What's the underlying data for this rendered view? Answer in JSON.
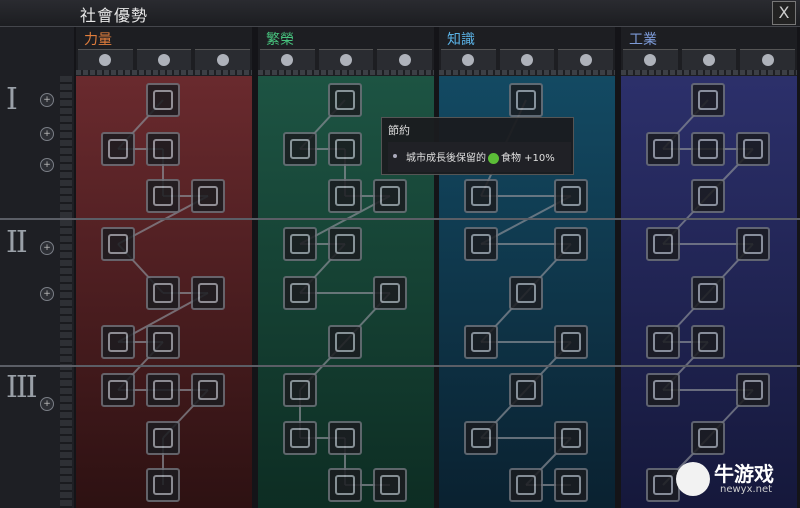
{
  "window": {
    "title": "社會優勢",
    "close_label": "X"
  },
  "tiers": [
    {
      "label": "I"
    },
    {
      "label": "II"
    },
    {
      "label": "III"
    }
  ],
  "columns": [
    {
      "name": "力量",
      "color": "#e07d3c",
      "bg_top": "#6a2a2e",
      "bg_bot": "#2d1112",
      "header_icons": [
        "fist-icon",
        "arm-icon",
        "arm-icon"
      ],
      "nodes_icons": [
        "chevrons-icon",
        "sword-icon",
        "person-icon",
        "stone-icon",
        "flag-icon",
        "helmet-icon",
        "ball-icon",
        "gem-icon",
        "tower-icon",
        "arrow-up-icon",
        "arrow-up-icon",
        "hexagon-icon",
        "tools-icon",
        "circle-arrows-icon",
        "fireball-icon"
      ]
    },
    {
      "name": "繁榮",
      "color": "#47c37e",
      "bg_top": "#1d5443",
      "bg_bot": "#0d2d23",
      "header_icons": [
        "leaf-icon",
        "leaf-icon",
        "leaf-icon"
      ],
      "nodes_icons": [
        "apple-icon",
        "scroll-icon",
        "chart-icon",
        "hand-icon",
        "book-icon",
        "lightning-icon",
        "sparkle-icon",
        "hand-coin-icon",
        "bulb-icon",
        "brain-icon",
        "lotus-icon",
        "star-burst-icon",
        "people-icon",
        "palm-icon",
        "cross-icon"
      ]
    },
    {
      "name": "知識",
      "color": "#5ab2e6",
      "bg_top": "#134a63",
      "bg_bot": "#0a2130",
      "header_icons": [
        "bust-icon",
        "bust-icon",
        "bust-icon"
      ],
      "nodes_icons": [
        "lamp-icon",
        "tube-icon",
        "bulb-icon",
        "quill-icon",
        "cog-icon",
        "network-icon",
        "hourglass-icon",
        "orb-icon",
        "microscope-icon",
        "eye-icon",
        "grad-cap-icon",
        "dart-icon",
        "pyramid-icon"
      ]
    },
    {
      "name": "工業",
      "color": "#7d9bd8",
      "bg_top": "#2c306b",
      "bg_bot": "#15183b",
      "header_icons": [
        "cube-icon",
        "cube-icon",
        "cube-icon"
      ],
      "nodes_icons": [
        "wrench-icon",
        "planet-icon",
        "star-icon",
        "arrows-icon",
        "ruler-icon",
        "recycle-icon",
        "pencil-icon",
        "pipes-icon",
        "orbit-icon",
        "triangle-icon",
        "heart-hand-icon",
        "hammer-icon",
        "column-icon",
        "pulse-icon"
      ]
    }
  ],
  "tooltip": {
    "title": "節約",
    "text_pre": "城市成長後保留的",
    "text_post": "食物 +10%",
    "icon": "food-icon"
  },
  "watermark": {
    "cn": "牛游戏",
    "en": "newyx.net"
  }
}
